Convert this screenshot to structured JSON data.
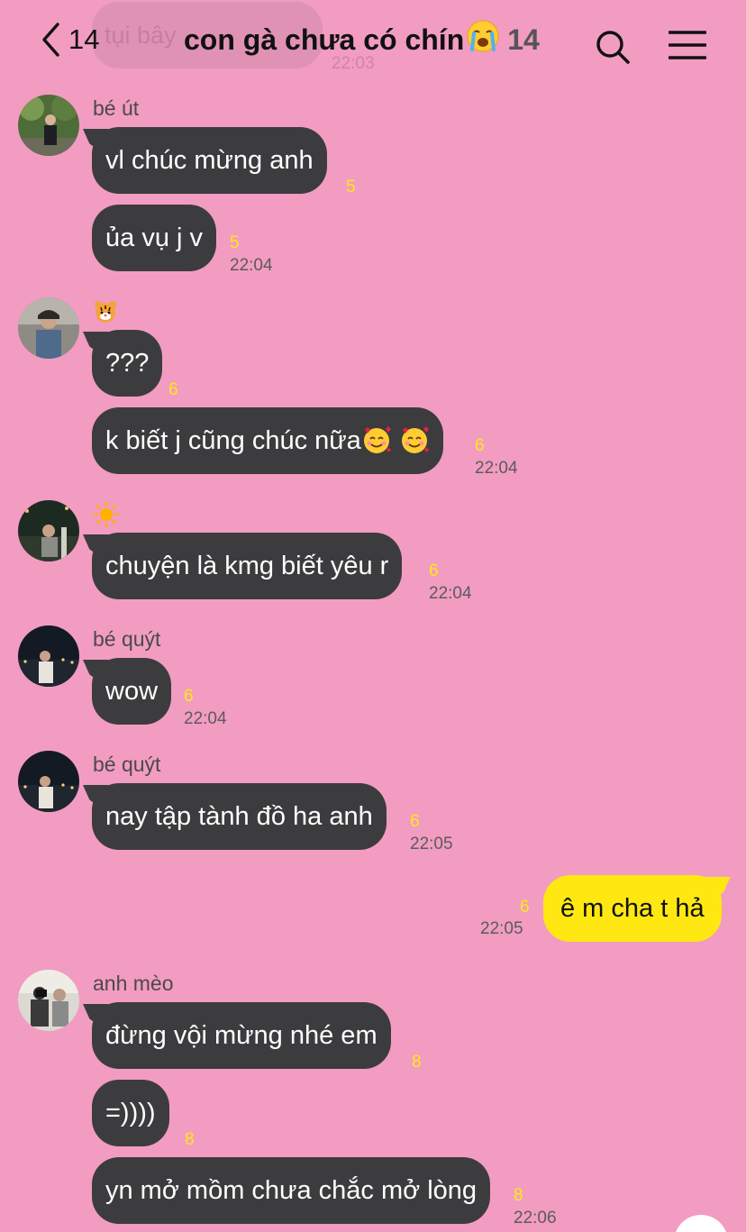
{
  "header": {
    "back_count": "14",
    "title": "con gà chưa có chín",
    "title_emoji": "😭",
    "member_count": "14",
    "ghost_message": "tụi bây",
    "ghost_time": "22:03"
  },
  "colors": {
    "background": "#F29CC2",
    "bubble_other": "#3C3C3E",
    "bubble_mine": "#FFE812",
    "unread": "#FFE812"
  },
  "messages": [
    {
      "sender": "bé út",
      "text": "vl chúc mừng anh",
      "unread": "5",
      "time": ""
    },
    {
      "sender": "",
      "text": "ủa vụ j v",
      "unread": "5",
      "time": "22:04"
    },
    {
      "sender": "🐯",
      "text": "???",
      "unread": "6",
      "time": ""
    },
    {
      "sender": "",
      "text": "k biết j cũng chúc nữa",
      "unread": "6",
      "time": "22:04"
    },
    {
      "sender": "☀️",
      "text": "chuyện là kmg biết yêu r",
      "unread": "6",
      "time": "22:04"
    },
    {
      "sender": "bé quýt",
      "text": "wow",
      "unread": "6",
      "time": "22:04"
    },
    {
      "sender": "bé quýt",
      "text": "nay tập tành đồ ha anh",
      "unread": "6",
      "time": "22:05"
    },
    {
      "sender": "",
      "text": "ê m cha t hả",
      "unread": "6",
      "time": "22:05"
    },
    {
      "sender": "anh mèo",
      "text": "đừng vội mừng nhé em",
      "unread": "8",
      "time": ""
    },
    {
      "sender": "",
      "text": "=))))",
      "unread": "8",
      "time": ""
    },
    {
      "sender": "",
      "text": "yn mở mồm chưa chắc mở lòng",
      "unread": "8",
      "time": "22:06"
    }
  ]
}
